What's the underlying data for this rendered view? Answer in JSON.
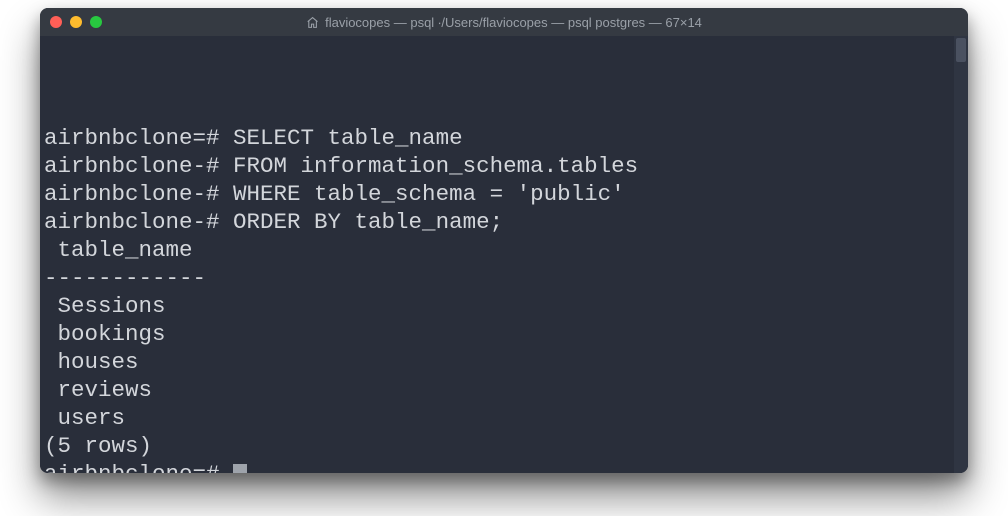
{
  "window": {
    "title": "flaviocopes — psql ∙/Users/flaviocopes — psql postgres — 67×14"
  },
  "traffic": {
    "red": "#ff5f57",
    "yellow": "#febc2e",
    "green": "#28c840"
  },
  "terminal": {
    "lines": [
      "airbnbclone=# SELECT table_name",
      "airbnbclone-# FROM information_schema.tables",
      "airbnbclone-# WHERE table_schema = 'public'",
      "airbnbclone-# ORDER BY table_name;",
      " table_name ",
      "------------",
      " Sessions",
      " bookings",
      " houses",
      " reviews",
      " users",
      "(5 rows)",
      "",
      "airbnbclone=# "
    ],
    "cursor_on_last": true
  }
}
